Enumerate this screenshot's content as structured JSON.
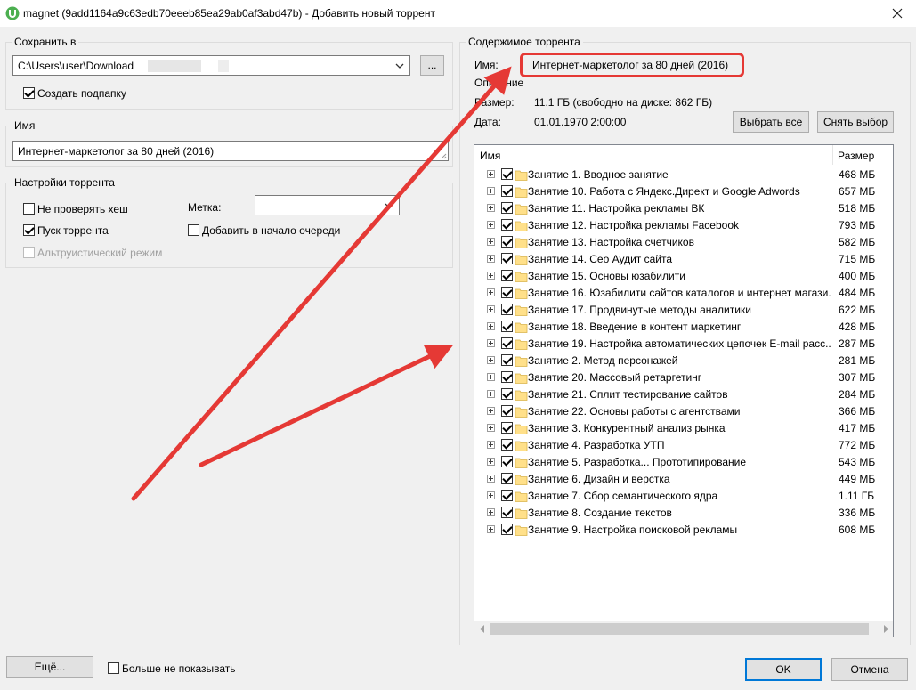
{
  "window": {
    "title": "magnet (9add1164a9c63edb70eeeb85ea29ab0af3abd47b) - Добавить новый торрент",
    "close_icon": "close-icon"
  },
  "save": {
    "legend": "Сохранить в",
    "path": "C:\\Users\\user\\Download",
    "browse_label": "...",
    "subfolder_label": "Создать подпапку",
    "subfolder_checked": true
  },
  "name_group": {
    "legend": "Имя",
    "value": "Интернет-маркетолог за 80 дней (2016)"
  },
  "settings": {
    "legend": "Настройки торрента",
    "skip_hash_label": "Не проверять хеш",
    "start_label": "Пуск торрента",
    "altruistic_label": "Альтруистический режим",
    "label_caption": "Метка:",
    "label_value": "",
    "queue_top_label": "Добавить в начало очереди"
  },
  "content": {
    "legend": "Содержимое торрента",
    "name_caption": "Имя:",
    "name_value": "Интернет-маркетолог за 80 дней (2016)",
    "desc_caption": "Описание",
    "size_caption": "Размер:",
    "size_value": "11.1 ГБ (свободно на диске: 862 ГБ)",
    "date_caption": "Дата:",
    "date_value": "01.01.1970 2:00:00",
    "select_all_label": "Выбрать все",
    "deselect_label": "Снять выбор",
    "col_name": "Имя",
    "col_size": "Размер",
    "files": [
      {
        "name": "Занятие 1. Вводное занятие",
        "size": "468 МБ"
      },
      {
        "name": "Занятие 10. Работа с Яндекс.Директ и Google Adwords",
        "size": "657 МБ"
      },
      {
        "name": "Занятие 11. Настройка рекламы ВК",
        "size": "518 МБ"
      },
      {
        "name": "Занятие 12. Настройка рекламы Facebook",
        "size": "793 МБ"
      },
      {
        "name": "Занятие 13. Настройка счетчиков",
        "size": "582 МБ"
      },
      {
        "name": "Занятие 14. Сео Аудит сайта",
        "size": "715 МБ"
      },
      {
        "name": "Занятие 15. Основы юзабилити",
        "size": "400 МБ"
      },
      {
        "name": "Занятие 16. Юзабилити сайтов каталогов и интернет магази...",
        "size": "484 МБ"
      },
      {
        "name": "Занятие 17. Продвинутые методы аналитики",
        "size": "622 МБ"
      },
      {
        "name": "Занятие 18. Введение в контент маркетинг",
        "size": "428 МБ"
      },
      {
        "name": "Занятие 19. Настройка автоматических цепочек E-mail расс...",
        "size": "287 МБ"
      },
      {
        "name": "Занятие 2. Метод персонажей",
        "size": "281 МБ"
      },
      {
        "name": "Занятие 20. Массовый ретаргетинг",
        "size": "307 МБ"
      },
      {
        "name": "Занятие 21. Сплит тестирование сайтов",
        "size": "284 МБ"
      },
      {
        "name": "Занятие 22. Основы работы с агентствами",
        "size": "366 МБ"
      },
      {
        "name": "Занятие 3. Конкурентный анализ рынка",
        "size": "417 МБ"
      },
      {
        "name": "Занятие 4. Разработка УТП",
        "size": "772 МБ"
      },
      {
        "name": "Занятие 5. Разработка... Прототипирование",
        "size": "543 МБ"
      },
      {
        "name": "Занятие 6. Дизайн и верстка",
        "size": "449 МБ"
      },
      {
        "name": "Занятие 7. Сбор семантического ядра",
        "size": "1.11 ГБ"
      },
      {
        "name": "Занятие 8. Создание текстов",
        "size": "336 МБ"
      },
      {
        "name": "Занятие 9. Настройка поисковой рекламы",
        "size": "608 МБ"
      }
    ]
  },
  "footer": {
    "more_label": "Ещё...",
    "dont_show_label": "Больше не показывать",
    "ok_label": "OK",
    "cancel_label": "Отмена"
  },
  "colors": {
    "annotation_red": "#e53935",
    "folder_yellow": "#ffe08a",
    "default_button_blue": "#0078d7"
  }
}
